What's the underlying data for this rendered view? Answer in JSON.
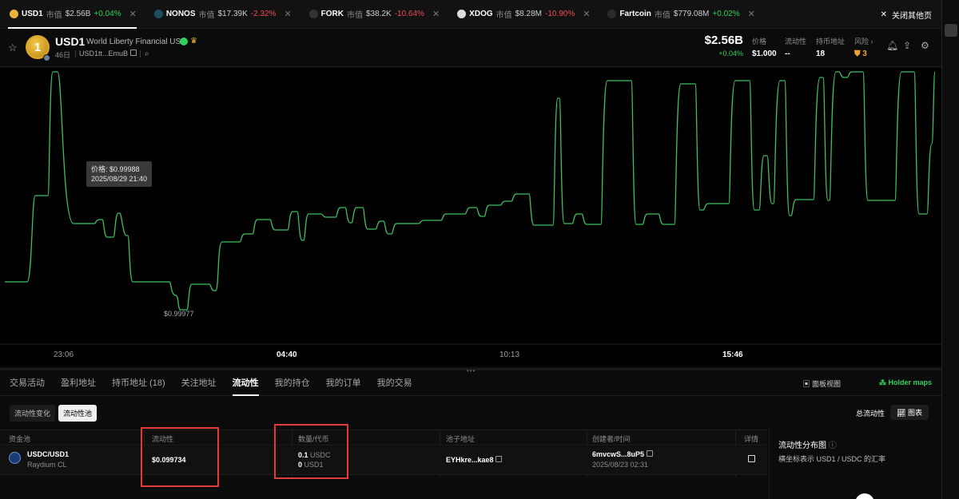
{
  "top_tabs": [
    {
      "symbol": "USD1",
      "mc_label": "市值",
      "mc_value": "$2.56B",
      "change": "+0.04%",
      "dir": "up",
      "icon": "usd1-coin-icon"
    },
    {
      "symbol": "NONOS",
      "mc_label": "市值",
      "mc_value": "$17.39K",
      "change": "-2.32%",
      "dir": "down",
      "icon": "nonos-logo-icon"
    },
    {
      "symbol": "FORK",
      "mc_label": "市值",
      "mc_value": "$38.2K",
      "change": "-10.64%",
      "dir": "down",
      "icon": "fork-logo-icon"
    },
    {
      "symbol": "XDOG",
      "mc_label": "市值",
      "mc_value": "$8.28M",
      "change": "-10.90%",
      "dir": "down",
      "icon": "xdog-logo-icon"
    },
    {
      "symbol": "Fartcoin",
      "mc_label": "市值",
      "mc_value": "$779.08M",
      "change": "+0.02%",
      "dir": "up",
      "icon": "fartcoin-logo-icon"
    }
  ],
  "close_others": "关闭其他页",
  "token": {
    "logo_char": "1",
    "symbol": "USD1",
    "name": "World Liberty Financial USD",
    "age": "46日",
    "address": "USD1tt...EmuB",
    "market_cap": "$2.56B",
    "market_cap_change": "+0.04%"
  },
  "stats": {
    "price_label": "价格",
    "price": "$1.000",
    "liquidity_label": "流动性",
    "liquidity": "--",
    "holders_label": "持币地址",
    "holders": "18",
    "risk_label": "风险 ›",
    "risk": "3"
  },
  "chart": {
    "tooltip_price": "价格: $0.99988",
    "tooltip_time": "2025/08/29 21:40",
    "min_label": "$0.99977",
    "x_ticks": [
      "23:06",
      "04:40",
      "10:13",
      "15:46"
    ],
    "line_color": "#3fbf5f"
  },
  "bottom_tabs": [
    "交易活动",
    "盈利地址",
    "持币地址 (18)",
    "关注地址",
    "流动性",
    "我的持仓",
    "我的订单",
    "我的交易"
  ],
  "active_bottom_tab": "流动性",
  "panel_view": "面板视图",
  "holder_maps": "Holder maps",
  "sub_tabs": [
    "流动性变化",
    "流动性池"
  ],
  "total_liquidity": "总流动性",
  "chart_button": "图表",
  "table": {
    "headers": [
      "资金池",
      "流动性",
      "数量/代币",
      "池子地址",
      "创建者/时间",
      "详情"
    ],
    "row": {
      "pair": "USDC/USD1",
      "dex": "Raydium CL",
      "liquidity": "$0.099734",
      "amount1_value": "0.1",
      "amount1_token": "USDC",
      "amount2_value": "0",
      "amount2_token": "USD1",
      "pool_address": "EYHkre...kae8",
      "creator": "6mvcwS...8uP5",
      "created_time": "2025/08/23 02:31"
    }
  },
  "distribution": {
    "title": "流动性分布图",
    "subtitle": "横坐标表示 USD1 / USDC 的汇率"
  },
  "colors": {
    "up": "#2fd05c",
    "down": "#f04c55",
    "highlight": "#e23b3b"
  }
}
